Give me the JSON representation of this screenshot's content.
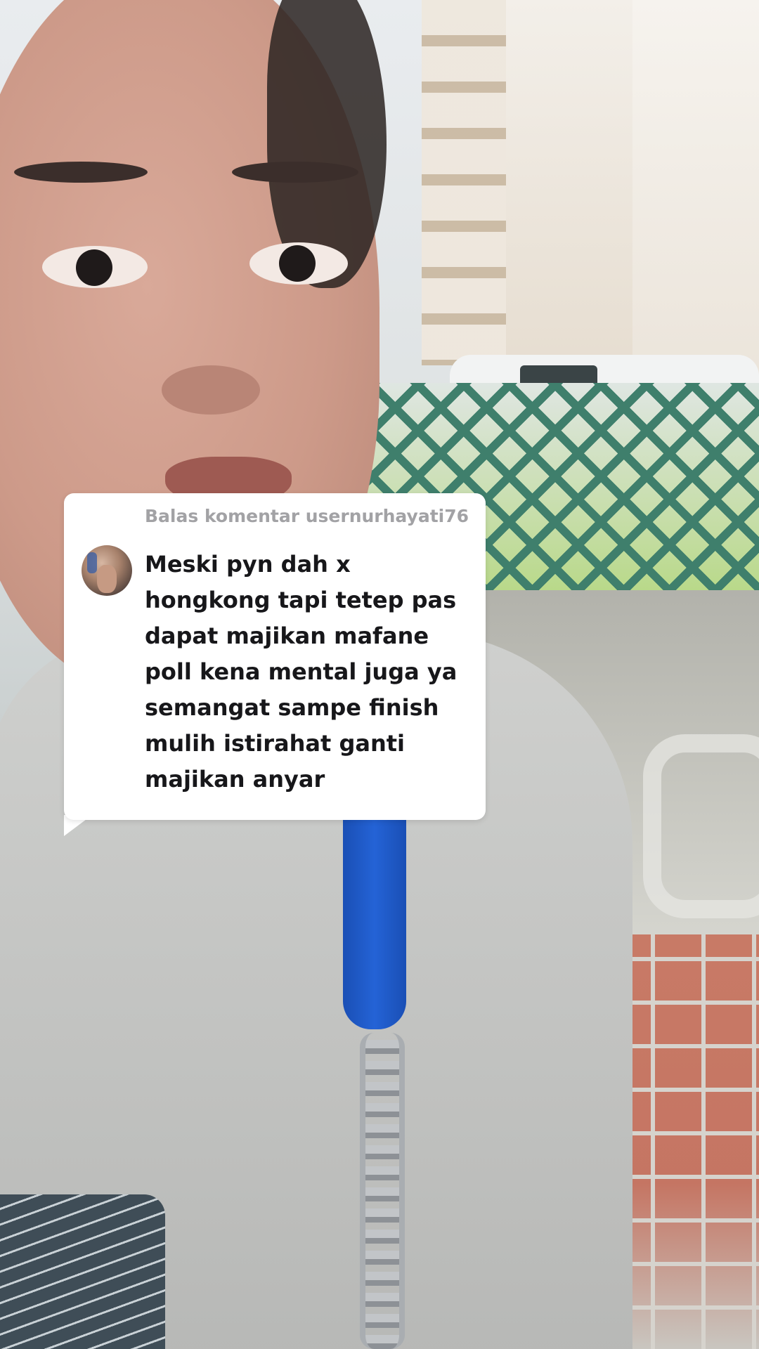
{
  "reply_sticker": {
    "header": "Balas komentar usernurhayati76",
    "comment_lines": [
      "Meski pyn dah x",
      "hongkong tapi tetep pas",
      "dapat majikan mafane",
      "poll kena mental juga ya",
      "semangat sampe finish",
      "mulih istirahat ganti",
      "majikan anyar"
    ],
    "avatar_icon": "user-avatar",
    "card_color": "#ffffff",
    "header_color": "#a2a2a5",
    "text_color": "#17171a"
  }
}
